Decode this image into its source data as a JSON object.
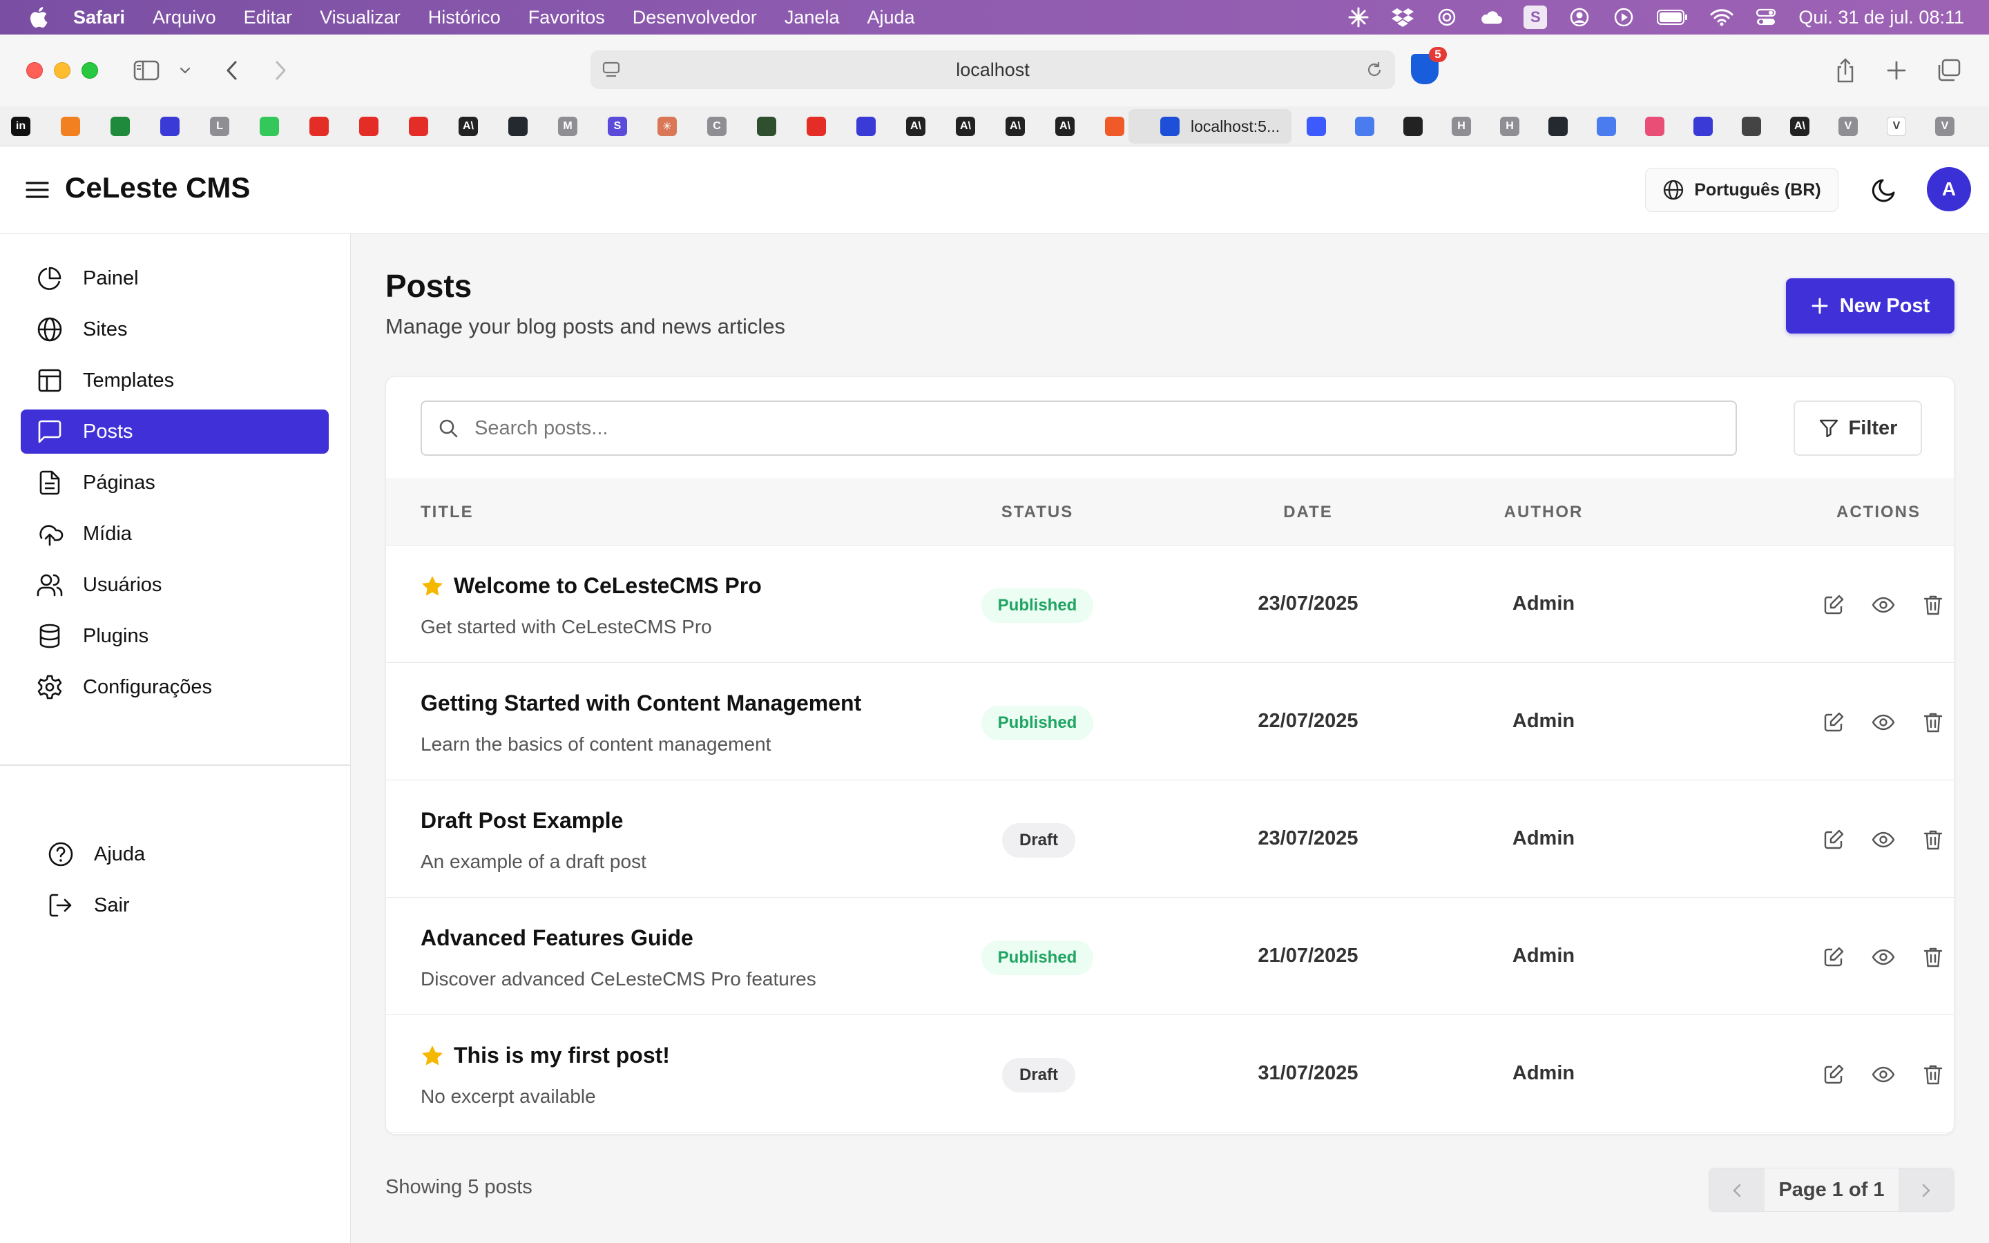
{
  "menubar": {
    "app_name": "Safari",
    "items": [
      "Arquivo",
      "Editar",
      "Visualizar",
      "Histórico",
      "Favoritos",
      "Desenvolvedor",
      "Janela",
      "Ajuda"
    ],
    "status_s_label": "S",
    "clock": "Qui. 31 de jul.  08:11"
  },
  "browser": {
    "url": "localhost",
    "extension_badge_count": "5",
    "active_tab_label": "localhost:5..."
  },
  "favorites": [
    {
      "label": "in",
      "color": "#111111"
    },
    {
      "label": "",
      "color": "#f38020"
    },
    {
      "label": "",
      "color": "#1f8a3b"
    },
    {
      "label": "",
      "color": "#3a3ad6"
    },
    {
      "label": "L",
      "color": "#8e8e93"
    },
    {
      "label": "",
      "color": "#34c759"
    },
    {
      "label": "",
      "color": "#e52d27"
    },
    {
      "label": "",
      "color": "#e52d27"
    },
    {
      "label": "",
      "color": "#e52d27"
    },
    {
      "label": "A\\",
      "color": "#222222"
    },
    {
      "label": "",
      "color": "#24292f"
    },
    {
      "label": "M",
      "color": "#8e8e93"
    },
    {
      "label": "S",
      "color": "#5b4bdb"
    },
    {
      "label": "✳",
      "color": "#d97757"
    },
    {
      "label": "C",
      "color": "#8e8e93"
    },
    {
      "label": "",
      "color": "#2f4f2f"
    },
    {
      "label": "",
      "color": "#e52d27"
    },
    {
      "label": "",
      "color": "#3a3ad6"
    },
    {
      "label": "A\\",
      "color": "#222222"
    },
    {
      "label": "A\\",
      "color": "#222222"
    },
    {
      "label": "A\\",
      "color": "#222222"
    },
    {
      "label": "A\\",
      "color": "#222222"
    },
    {
      "label": "",
      "color": "#f05a28"
    }
  ],
  "favorites_right": [
    {
      "label": "",
      "color": "#3d5afe"
    },
    {
      "label": "",
      "color": "#4a7cf0"
    },
    {
      "label": "",
      "color": "#222222"
    },
    {
      "label": "H",
      "color": "#8e8e93"
    },
    {
      "label": "H",
      "color": "#8e8e93"
    },
    {
      "label": "",
      "color": "#24292f"
    },
    {
      "label": "",
      "color": "#4a7cf0"
    },
    {
      "label": "",
      "color": "#e94e77"
    },
    {
      "label": "",
      "color": "#3a3ad6"
    },
    {
      "label": "",
      "color": "#444444"
    },
    {
      "label": "A\\",
      "color": "#222222"
    },
    {
      "label": "V",
      "color": "#8e8e93"
    },
    {
      "label": "V",
      "color": "#ffffff"
    },
    {
      "label": "V",
      "color": "#8e8e93"
    }
  ],
  "header": {
    "app_title": "CeLeste CMS",
    "language": "Português (BR)",
    "avatar_initial": "A"
  },
  "sidebar": {
    "items": [
      {
        "label": "Painel",
        "icon": "pie-chart-icon"
      },
      {
        "label": "Sites",
        "icon": "globe-icon"
      },
      {
        "label": "Templates",
        "icon": "layout-icon"
      },
      {
        "label": "Posts",
        "icon": "message-square-icon",
        "active": true
      },
      {
        "label": "Páginas",
        "icon": "file-text-icon"
      },
      {
        "label": "Mídia",
        "icon": "upload-cloud-icon"
      },
      {
        "label": "Usuários",
        "icon": "users-icon"
      },
      {
        "label": "Plugins",
        "icon": "database-icon"
      },
      {
        "label": "Configurações",
        "icon": "gear-icon"
      }
    ],
    "bottom_items": [
      {
        "label": "Ajuda",
        "icon": "help-circle-icon"
      },
      {
        "label": "Sair",
        "icon": "log-out-icon"
      }
    ]
  },
  "main": {
    "title": "Posts",
    "subtitle": "Manage your blog posts and news articles",
    "new_post_label": "New Post",
    "search_placeholder": "Search posts...",
    "search_value": "",
    "filter_label": "Filter",
    "columns": [
      "TITLE",
      "STATUS",
      "DATE",
      "AUTHOR",
      "ACTIONS"
    ],
    "posts": [
      {
        "title": "Welcome to CeLesteCMS Pro",
        "excerpt": "Get started with CeLesteCMS Pro",
        "status": "Published",
        "date": "23/07/2025",
        "author": "Admin",
        "featured": true
      },
      {
        "title": "Getting Started with Content Management",
        "excerpt": "Learn the basics of content management",
        "status": "Published",
        "date": "22/07/2025",
        "author": "Admin",
        "featured": false
      },
      {
        "title": "Draft Post Example",
        "excerpt": "An example of a draft post",
        "status": "Draft",
        "date": "23/07/2025",
        "author": "Admin",
        "featured": false
      },
      {
        "title": "Advanced Features Guide",
        "excerpt": "Discover advanced CeLesteCMS Pro features",
        "status": "Published",
        "date": "21/07/2025",
        "author": "Admin",
        "featured": false
      },
      {
        "title": "This is my first post!",
        "excerpt": "No excerpt available",
        "status": "Draft",
        "date": "31/07/2025",
        "author": "Admin",
        "featured": true
      }
    ],
    "footer_count": "Showing 5 posts",
    "pagination": "Page 1 of 1"
  },
  "colors": {
    "primary": "#4030d8",
    "published_text": "#1fa463",
    "published_bg": "#ecfdf3",
    "star": "#f5b700"
  }
}
